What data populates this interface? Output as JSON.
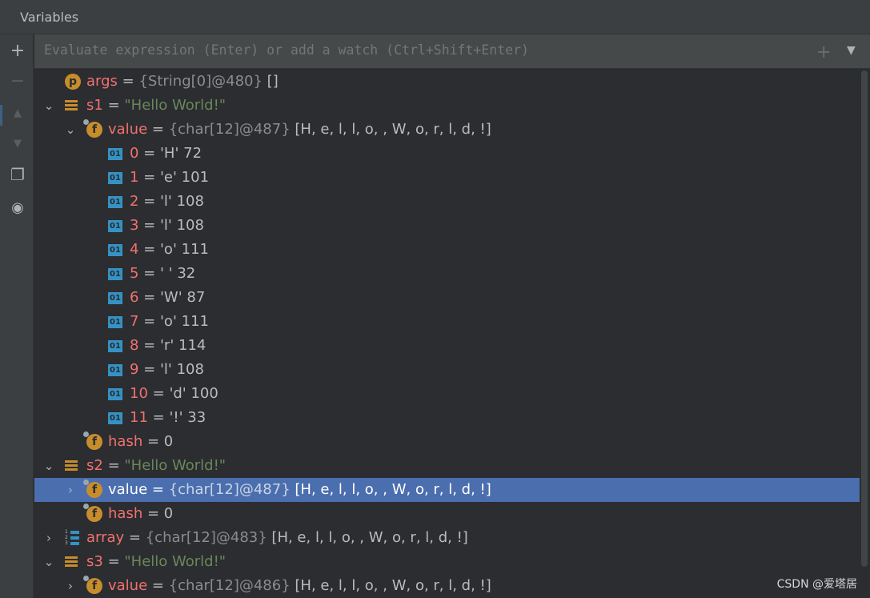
{
  "panel": {
    "title": "Variables"
  },
  "toolbar": {
    "items": [
      {
        "name": "add-icon",
        "glyph": "+"
      },
      {
        "name": "remove-icon",
        "glyph": "−"
      },
      {
        "name": "move-up-icon",
        "glyph": "▲"
      },
      {
        "name": "move-down-icon",
        "glyph": "▼"
      },
      {
        "name": "copy-icon",
        "glyph": "❐"
      },
      {
        "name": "view-options-icon",
        "glyph": "◉"
      }
    ]
  },
  "eval": {
    "placeholder": "Evaluate expression (Enter) or add a watch (Ctrl+Shift+Enter)",
    "add_glyph": "+",
    "dropdown_glyph": "▼"
  },
  "colors": {
    "background": "#2b2d30",
    "selection": "#4b6eaf",
    "name": "#f2716f",
    "string": "#6a8759",
    "field_icon": "#c78d2c",
    "primitive_icon": "#3592c4"
  },
  "tree": [
    {
      "depth": 0,
      "arrow": "",
      "icon": "p",
      "name": "args",
      "ref": "{String[0]@480}",
      "value": "[]"
    },
    {
      "depth": 0,
      "arrow": "⌄",
      "icon": "obj",
      "name": "s1",
      "str": "\"Hello World!\""
    },
    {
      "depth": 1,
      "arrow": "⌄",
      "icon": "f",
      "name": "value",
      "ref": "{char[12]@487}",
      "value": "[H, e, l, l, o,  , W, o, r, l, d, !]"
    },
    {
      "depth": 2,
      "arrow": "",
      "icon": "01",
      "name": "0",
      "value": "'H' 72"
    },
    {
      "depth": 2,
      "arrow": "",
      "icon": "01",
      "name": "1",
      "value": "'e' 101"
    },
    {
      "depth": 2,
      "arrow": "",
      "icon": "01",
      "name": "2",
      "value": "'l' 108"
    },
    {
      "depth": 2,
      "arrow": "",
      "icon": "01",
      "name": "3",
      "value": "'l' 108"
    },
    {
      "depth": 2,
      "arrow": "",
      "icon": "01",
      "name": "4",
      "value": "'o' 111"
    },
    {
      "depth": 2,
      "arrow": "",
      "icon": "01",
      "name": "5",
      "value": "' ' 32"
    },
    {
      "depth": 2,
      "arrow": "",
      "icon": "01",
      "name": "6",
      "value": "'W' 87"
    },
    {
      "depth": 2,
      "arrow": "",
      "icon": "01",
      "name": "7",
      "value": "'o' 111"
    },
    {
      "depth": 2,
      "arrow": "",
      "icon": "01",
      "name": "8",
      "value": "'r' 114"
    },
    {
      "depth": 2,
      "arrow": "",
      "icon": "01",
      "name": "9",
      "value": "'l' 108"
    },
    {
      "depth": 2,
      "arrow": "",
      "icon": "01",
      "name": "10",
      "value": "'d' 100"
    },
    {
      "depth": 2,
      "arrow": "",
      "icon": "01",
      "name": "11",
      "value": "'!' 33"
    },
    {
      "depth": 1,
      "arrow": "",
      "icon": "f",
      "name": "hash",
      "value": "0"
    },
    {
      "depth": 0,
      "arrow": "⌄",
      "icon": "obj",
      "name": "s2",
      "str": "\"Hello World!\""
    },
    {
      "depth": 1,
      "arrow": "›",
      "icon": "f",
      "name": "value",
      "ref": "{char[12]@487}",
      "value": "[H, e, l, l, o,  , W, o, r, l, d, !]",
      "selected": true
    },
    {
      "depth": 1,
      "arrow": "",
      "icon": "f",
      "name": "hash",
      "value": "0"
    },
    {
      "depth": 0,
      "arrow": "›",
      "icon": "arr",
      "name": "array",
      "ref": "{char[12]@483}",
      "value": "[H, e, l, l, o,  , W, o, r, l, d, !]"
    },
    {
      "depth": 0,
      "arrow": "⌄",
      "icon": "obj",
      "name": "s3",
      "str": "\"Hello World!\""
    },
    {
      "depth": 1,
      "arrow": "›",
      "icon": "f",
      "name": "value",
      "ref": "{char[12]@486}",
      "value": "[H, e, l, l, o,  , W, o, r, l, d, !]"
    }
  ],
  "watermark": "CSDN @爱塔居"
}
